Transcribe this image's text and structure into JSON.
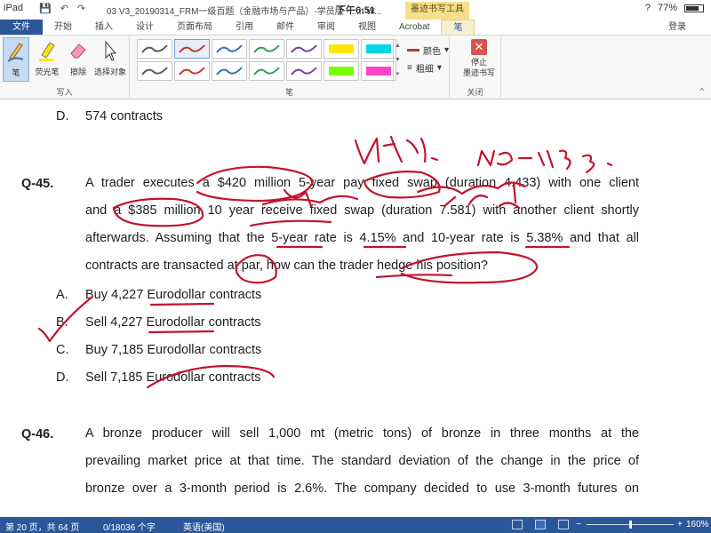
{
  "status_strip": {
    "device": "iPad",
    "clock": "下午6:51",
    "battery": "77%",
    "document_title": "03 V3_20190314_FRM一级百题（金融市场与产品）-学员版 - ...h W...",
    "context_tab": "墨迹书写工具"
  },
  "ribbon_tabs": [
    "文件",
    "开始",
    "插入",
    "设计",
    "页面布局",
    "引用",
    "邮件",
    "审阅",
    "视图",
    "Acrobat",
    "笔"
  ],
  "login_label": "登录",
  "ribbon": {
    "write_group": {
      "label": "写入",
      "tools": [
        "笔",
        "荧光笔",
        "擦除",
        "选择对象"
      ]
    },
    "pens_group": {
      "label": "笔",
      "color_label": "颜色",
      "thickness_label": "粗细",
      "pen_colors": [
        "#5a5a5a",
        "#c0392b",
        "#3a6fb6",
        "#2e9e5b",
        "#7a3fa0",
        "#ffe600",
        "#00d7e6",
        "#5a5a5a",
        "#c0392b",
        "#3a6fb6",
        "#2e9e5b",
        "#7a3fa0",
        "#7cff00",
        "#ff44c8"
      ]
    },
    "close_group": {
      "label": "关闭",
      "stop_label_1": "停止",
      "stop_label_2": "墨迹书写"
    }
  },
  "document": {
    "prev_option": {
      "letter": "D.",
      "text": "574 contracts"
    },
    "q45": {
      "number": "Q-45.",
      "lines": [
        "A trader executes a $420 million 5-year pay fixed swap (duration 4.433) with one client",
        "and a $385 million 10 year receive fixed swap (duration 7.581) with another client shortly",
        "afterwards. Assuming that the 5-year rate is 4.15% and 10-year rate is 5.38% and that all",
        "contracts are transacted at par, how can the trader hedge his position?"
      ],
      "options": [
        {
          "letter": "A.",
          "text": "Buy 4,227 Eurodollar contracts"
        },
        {
          "letter": "B.",
          "text": "Sell 4,227 Eurodollar contracts"
        },
        {
          "letter": "C.",
          "text": "Buy 7,185 Eurodollar contracts"
        },
        {
          "letter": "D.",
          "text": "Sell 7,185 Eurodollar contracts"
        }
      ]
    },
    "q46": {
      "number": "Q-46.",
      "lines": [
        "A bronze producer will sell 1,000 mt (metric tons) of bronze in three months at the",
        "prevailing market price at that time. The standard deviation of the change in the price of",
        "bronze over a 3-month period is 2.6%. The company decided to use 3-month futures on"
      ]
    }
  },
  "statusbar": {
    "page": "第 20 页，共 64 页",
    "words": "0/18036 个字",
    "language": "英语(美国)",
    "zoom": "160%",
    "zoom_level_fraction": 0.5
  },
  "ink_color": "#c4122f"
}
